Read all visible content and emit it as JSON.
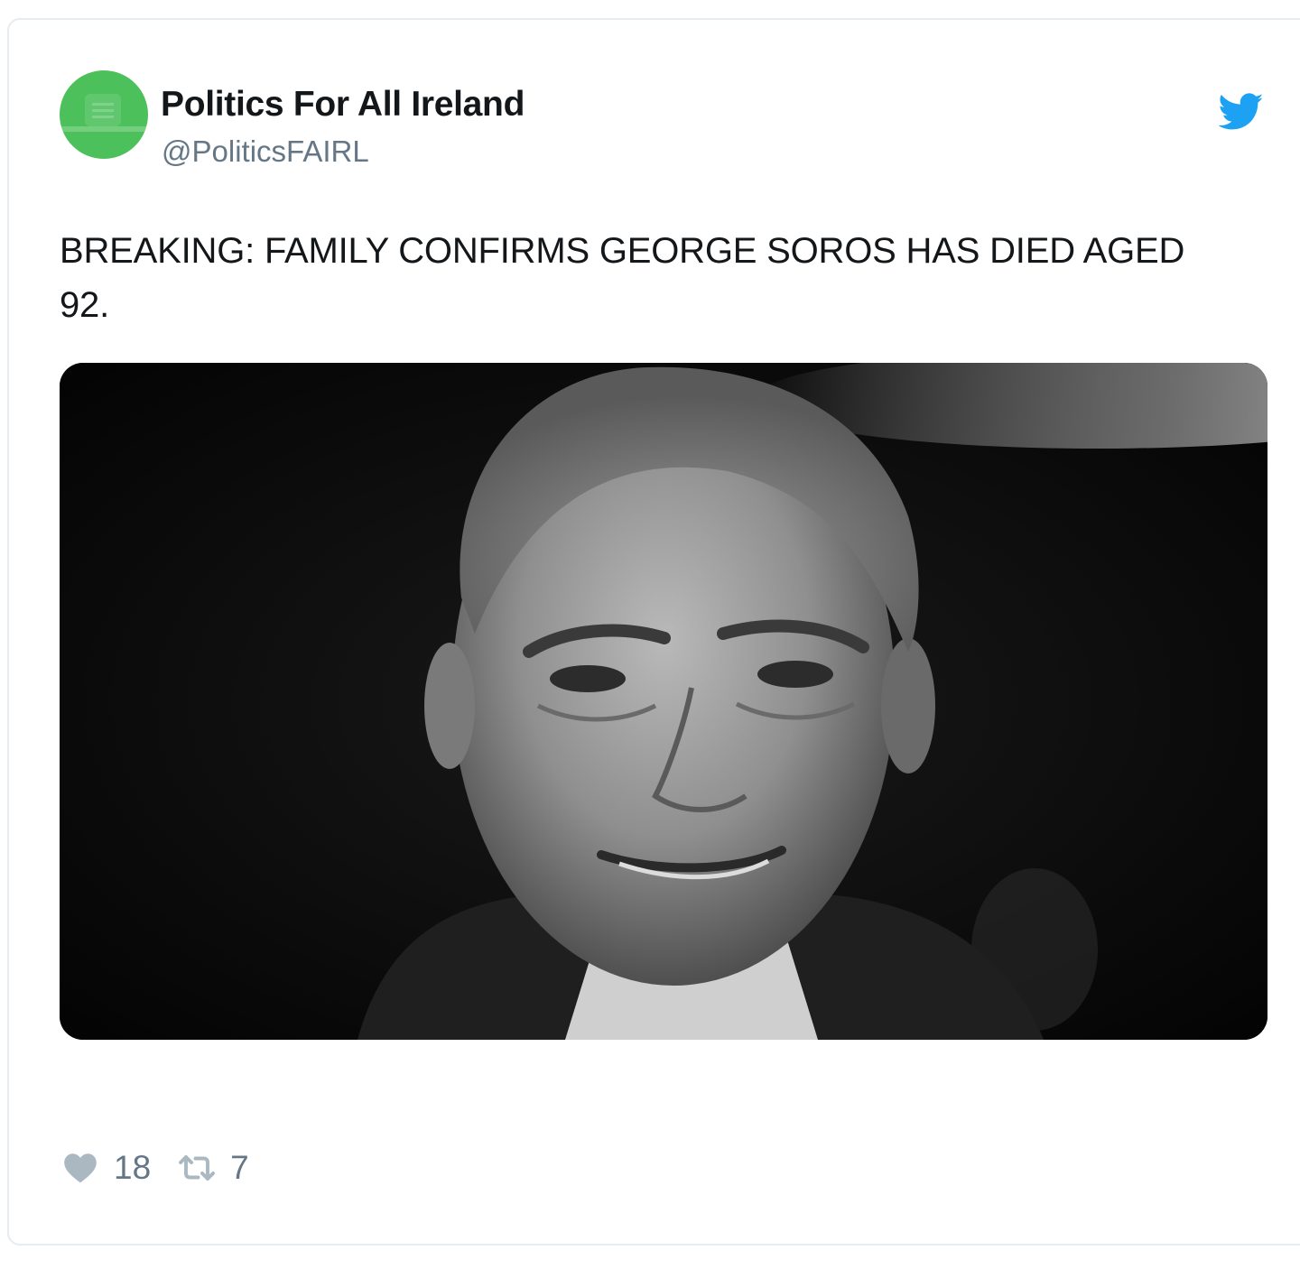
{
  "tweet": {
    "display_name": "Politics For All Ireland",
    "handle": "@PoliticsFAIRL",
    "text": "BREAKING: FAMILY CONFIRMS GEORGE SOROS HAS DIED AGED 92.",
    "avatar": {
      "color": "#4cc05a"
    },
    "media": {
      "description": "black-and-white close-up portrait of George Soros smiling"
    },
    "platform_icon": "twitter-bird-icon",
    "stats": {
      "likes": "18",
      "retweets": "7"
    }
  },
  "colors": {
    "twitter_blue": "#1da1f2",
    "text_primary": "#14171a",
    "text_secondary": "#657786",
    "action_icon": "#aab8c2"
  }
}
